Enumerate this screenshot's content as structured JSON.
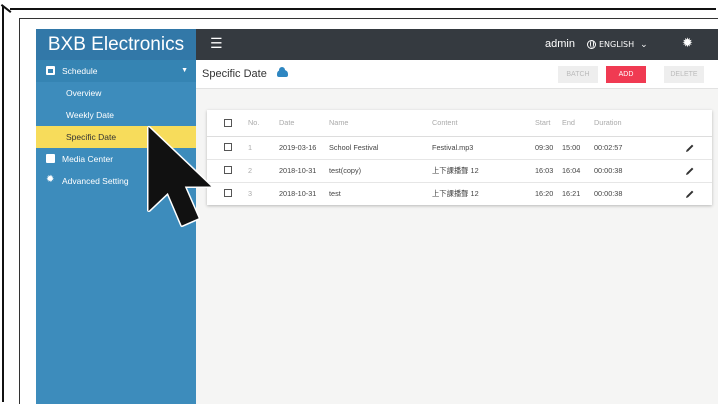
{
  "brand": "BXB Electronics",
  "topbar": {
    "user": "admin",
    "language": "ENGLISH"
  },
  "sidebar": {
    "schedule": "Schedule",
    "sub_items": [
      "Overview",
      "Weekly Date",
      "Specific Date"
    ],
    "media_center": "Media Center",
    "advanced_setting": "Advanced Setting"
  },
  "page": {
    "title": "Specific Date"
  },
  "buttons": {
    "batch": "BATCH",
    "add": "ADD",
    "delete": "DELETE"
  },
  "table": {
    "headers": [
      "No.",
      "Date",
      "Name",
      "Content",
      "Start",
      "End",
      "Duration"
    ],
    "rows": [
      {
        "no": "1",
        "date": "2019-03-16",
        "name": "School Festival",
        "content": "Festival.mp3",
        "start": "09:30",
        "end": "15:00",
        "duration": "00:02:57"
      },
      {
        "no": "2",
        "date": "2018-10-31",
        "name": "test(copy)",
        "content": "上下課播聲 12",
        "start": "16:03",
        "end": "16:04",
        "duration": "00:00:38"
      },
      {
        "no": "3",
        "date": "2018-10-31",
        "name": "test",
        "content": "上下課播聲 12",
        "start": "16:20",
        "end": "16:21",
        "duration": "00:00:38"
      }
    ]
  },
  "colors": {
    "sidebar": "#3d8cbc",
    "topbar": "#353a40",
    "active_item": "#f7dc5b",
    "add_button": "#f03a52"
  }
}
